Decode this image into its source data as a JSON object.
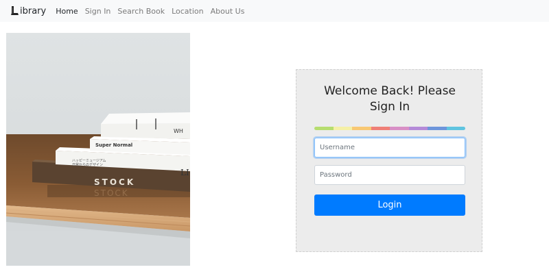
{
  "navbar": {
    "brand_text": "ibrary",
    "brand_logo": "L-book-logo",
    "links": [
      {
        "label": "Home",
        "active": true
      },
      {
        "label": "Sign In"
      },
      {
        "label": "Search Book"
      },
      {
        "label": "Location"
      },
      {
        "label": "About Us"
      }
    ],
    "background": "#f8f9fa"
  },
  "photo": {
    "description_icon": "stacked-books-photo",
    "book_labels": [
      "Super Normal",
      "STOCK",
      "WH",
      "LI"
    ]
  },
  "login_card": {
    "title": "Welcome Back! Please Sign In",
    "rainbow_colors": [
      "#b6dd6f",
      "#f5f0a6",
      "#f8c873",
      "#ef7f77",
      "#d88fc6",
      "#b48ad8",
      "#6d95db",
      "#5fc4e0"
    ],
    "username": {
      "value": "",
      "placeholder": "Username"
    },
    "password": {
      "value": "",
      "placeholder": "Password"
    },
    "login_label": "Login",
    "accent": "#007bff"
  }
}
